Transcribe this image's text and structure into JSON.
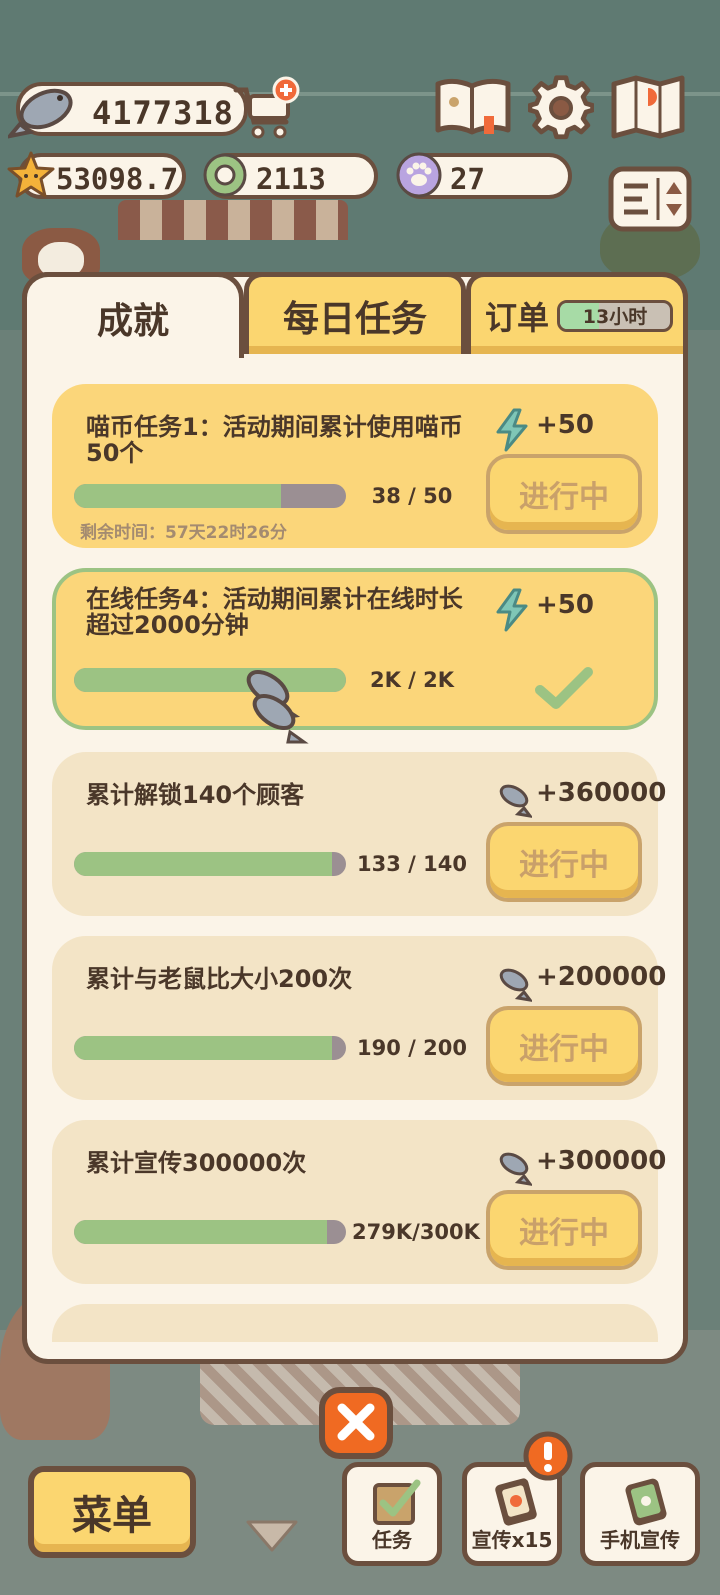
{
  "currencies": {
    "fish": "4177318",
    "star": "53098.7",
    "ring": "2113",
    "paw": "27"
  },
  "tabs": {
    "achievements": "成就",
    "daily": "每日任务",
    "order": "订单",
    "order_timer": "13小时",
    "order_timer_fill": 0.35
  },
  "tasks": [
    {
      "title": "喵币任务1：活动期间累计使用喵币50个",
      "reward": "+50",
      "reward_icon": "lightning-icon",
      "progress_text": "38  /  50",
      "progress": 0.76,
      "button": "进行中",
      "remaining": "剩余时间：57天22时26分",
      "state": "in-progress"
    },
    {
      "title": "在线任务4：活动期间累计在线时长超过2000分钟",
      "reward": "+50",
      "reward_icon": "lightning-icon",
      "progress_text": "2K  /  2K",
      "progress": 1.0,
      "state": "complete"
    },
    {
      "title": "累计解锁140个顾客",
      "reward": "+360000",
      "reward_icon": "fish-icon",
      "progress_text": "133 / 140",
      "progress": 0.95,
      "button": "进行中",
      "state": "in-progress"
    },
    {
      "title": "累计与老鼠比大小200次",
      "reward": "+200000",
      "reward_icon": "fish-icon",
      "progress_text": "190 / 200",
      "progress": 0.95,
      "button": "进行中",
      "state": "in-progress"
    },
    {
      "title": "累计宣传300000次",
      "reward": "+300000",
      "reward_icon": "fish-icon",
      "progress_text": "279K/300K",
      "progress": 0.93,
      "button": "进行中",
      "state": "in-progress"
    }
  ],
  "bottom": {
    "menu": "菜单",
    "task": "任务",
    "promo": "宣传x15",
    "phone_promo": "手机宣传"
  },
  "colors": {
    "panel_border": "#6b4f3e",
    "card_yellow": "#fbd67a",
    "card_beige": "#f3e4c6",
    "progress_green": "#9cc383",
    "button_yellow": "#fbd670",
    "close_orange": "#f06a22"
  }
}
